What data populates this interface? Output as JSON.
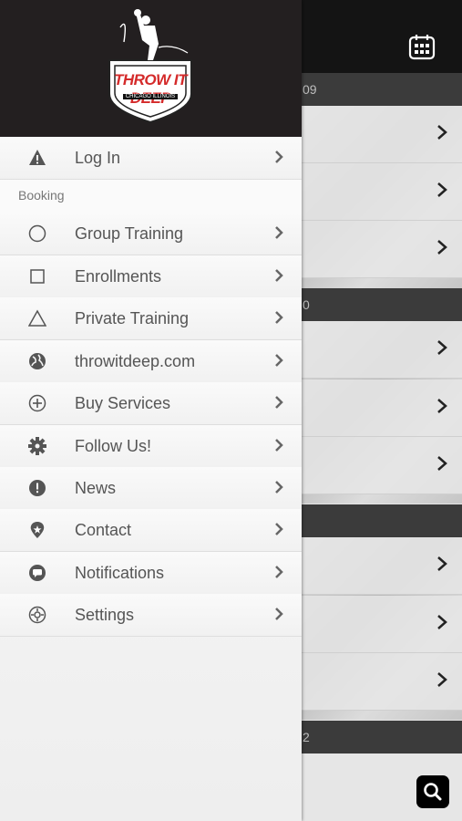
{
  "menu": {
    "login": "Log In",
    "section": "Booking",
    "items": [
      {
        "label": "Group Training",
        "icon": "circle-icon"
      },
      {
        "label": "Enrollments",
        "icon": "square-icon"
      },
      {
        "label": "Private Training",
        "icon": "triangle-icon"
      },
      {
        "label": "throwitdeep.com",
        "icon": "globe-icon"
      },
      {
        "label": "Buy Services",
        "icon": "plus-circle-icon"
      },
      {
        "label": "Follow Us!",
        "icon": "gear-icon"
      },
      {
        "label": "News",
        "icon": "exclamation-icon"
      },
      {
        "label": "Contact",
        "icon": "location-pin-icon"
      },
      {
        "label": "Notifications",
        "icon": "chat-icon"
      },
      {
        "label": "Settings",
        "icon": "cog-icon"
      }
    ]
  },
  "logo": {
    "title": "THROW IT DEEP",
    "location": "CHICAGO ILLINOIS"
  },
  "background": {
    "sections": [
      "09",
      "0",
      "",
      "2"
    ]
  },
  "colors": {
    "header": "#231f20",
    "logo_red": "#d42a2a"
  }
}
